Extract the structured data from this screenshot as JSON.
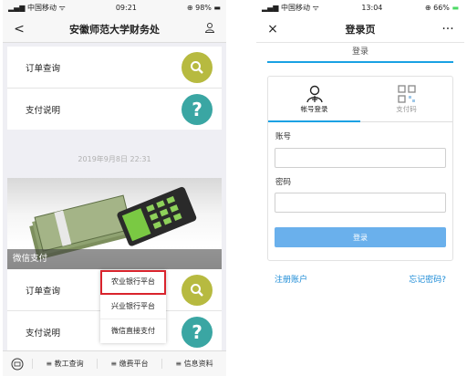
{
  "left_phone": {
    "status": {
      "carrier": "中国移动",
      "time": "09:21",
      "battery": "98%"
    },
    "nav": {
      "back": "<",
      "title": "安徽师范大学财务处",
      "user_icon": "person-icon"
    },
    "top_card": [
      {
        "label": "订单查询",
        "icon": "search-icon",
        "color": "#b7ba40"
      },
      {
        "label": "支付说明",
        "icon": "question-icon",
        "color": "#3aa6a3"
      }
    ],
    "timestamp": "2019年9月8日 22:31",
    "banner_caption": "微信支付",
    "bottom_card": [
      {
        "label": "订单查询",
        "icon": "search-icon",
        "color": "#b7ba40"
      },
      {
        "label": "支付说明",
        "icon": "question-icon",
        "color": "#3aa6a3"
      }
    ],
    "popup_menu": [
      "农业银行平台",
      "兴业银行平台",
      "微信直接支付"
    ],
    "popup_selected_color": "#d9232c",
    "tabbar": [
      "教工查询",
      "缴费平台",
      "信息资料"
    ]
  },
  "right_phone": {
    "status": {
      "carrier": "中国移动",
      "time": "13:04",
      "battery": "66%"
    },
    "nav": {
      "close": "×",
      "title": "登录页",
      "more": "···"
    },
    "subtitle": "登录",
    "tabs": [
      {
        "label": "帐号登录",
        "icon": "user-icon",
        "active": true
      },
      {
        "label": "支付码",
        "icon": "qr-code-icon",
        "active": false
      }
    ],
    "account_label": "账号",
    "account_value": "",
    "password_label": "密码",
    "password_value": "",
    "login_button": "登录",
    "register_link": "注册账户",
    "forgot_link": "忘记密码?",
    "accent_color": "#1aa1e3"
  }
}
